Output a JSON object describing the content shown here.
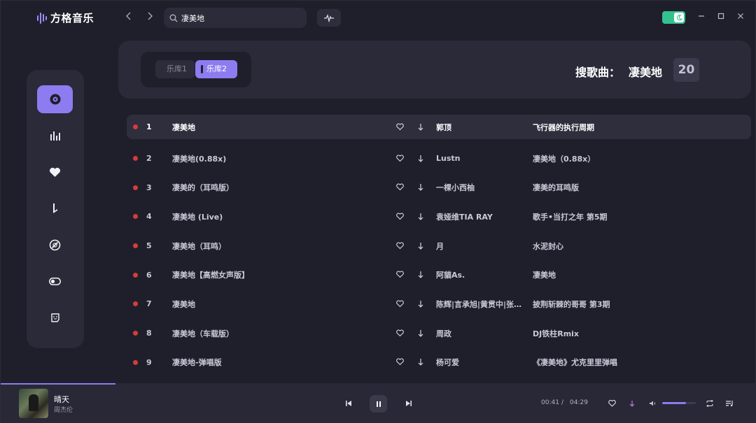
{
  "app": {
    "name": "方格音乐",
    "theme_toggle_color": "#34c38f",
    "accent_color": "#8b7cf0"
  },
  "search": {
    "value": "凄美地",
    "placeholder": ""
  },
  "window_controls": [
    "minimize-icon",
    "maximize-icon",
    "close-icon"
  ],
  "sidebar": {
    "items": [
      {
        "name": "disc-icon",
        "active": true
      },
      {
        "name": "chart-bars-icon",
        "active": false
      },
      {
        "name": "heart-icon",
        "active": false
      },
      {
        "name": "music-note-icon",
        "active": false
      },
      {
        "name": "vinyl-icon",
        "active": false
      },
      {
        "name": "toggle-icon",
        "active": false
      },
      {
        "name": "emoji-icon",
        "active": false
      }
    ]
  },
  "header": {
    "library_tabs": [
      "乐库1",
      "乐库2"
    ],
    "active_library": 1,
    "search_label": "搜歌曲：",
    "search_keyword": "凄美地",
    "result_count": "20"
  },
  "songs": [
    {
      "index": "1",
      "title": "凄美地",
      "artist": "郭顶",
      "album": "飞行器的执行周期",
      "active": true
    },
    {
      "index": "2",
      "title": "凄美地(0.88x)",
      "artist": "Lustn",
      "album": "凄美地（0.88x）"
    },
    {
      "index": "3",
      "title": "凄美的（耳鸣版）",
      "artist": "一棵小西柚",
      "album": "凄美的耳鸣版"
    },
    {
      "index": "4",
      "title": "凄美地 (Live)",
      "artist": "袁娅维TIA RAY",
      "album": "歌手•当打之年 第5期"
    },
    {
      "index": "5",
      "title": "凄美地（耳鸣）",
      "artist": "月",
      "album": "水泥封心"
    },
    {
      "index": "6",
      "title": "凄美地【高燃女声版】",
      "artist": "阿貓As.",
      "album": "凄美地"
    },
    {
      "index": "7",
      "title": "凄美地",
      "artist": "陈辉|言承旭|黄贯中|张…",
      "album": "披荆斩棘的哥哥 第3期"
    },
    {
      "index": "8",
      "title": "凄美地（车载版）",
      "artist": "周政",
      "album": "DJ铁柱Rmix"
    },
    {
      "index": "9",
      "title": "凄美地-弹唱版",
      "artist": "杨可爱",
      "album": "《凄美地》尤克里里弹唱"
    }
  ],
  "player": {
    "title": "晴天",
    "artist": "周杰伦",
    "current_time": "00:41",
    "separator": "/",
    "duration": "04:29",
    "progress": 0.152,
    "volume": 0.7
  }
}
